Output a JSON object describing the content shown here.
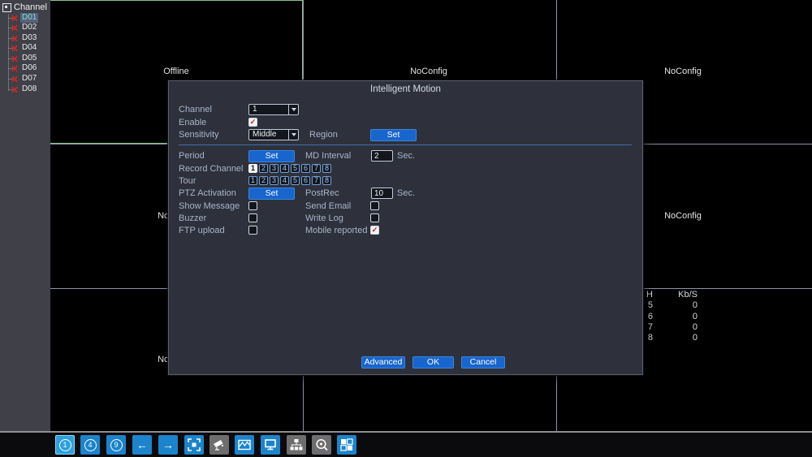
{
  "sidebar": {
    "title": "Channel",
    "items": [
      {
        "label": "D01",
        "selected": true
      },
      {
        "label": "D02",
        "selected": false
      },
      {
        "label": "D03",
        "selected": false
      },
      {
        "label": "D04",
        "selected": false
      },
      {
        "label": "D05",
        "selected": false
      },
      {
        "label": "D06",
        "selected": false
      },
      {
        "label": "D07",
        "selected": false
      },
      {
        "label": "D08",
        "selected": false
      }
    ]
  },
  "grid": {
    "cells": [
      {
        "position": "top-left",
        "label": "Offline"
      },
      {
        "position": "top-center",
        "label": "NoConfig"
      },
      {
        "position": "top-right",
        "label": "NoConfig"
      },
      {
        "position": "middle-left",
        "label": "NoConfig"
      },
      {
        "position": "middle-right",
        "label": "NoConfig"
      },
      {
        "position": "bottom-left",
        "label": "NoConfig"
      }
    ],
    "bitrate_table": {
      "header_ch": "H",
      "header_kbs": "Kb/S",
      "rows": [
        {
          "ch": "5",
          "kbs": "0"
        },
        {
          "ch": "6",
          "kbs": "0"
        },
        {
          "ch": "7",
          "kbs": "0"
        },
        {
          "ch": "8",
          "kbs": "0"
        }
      ]
    },
    "selected_cell_border_color": "#8cc08c"
  },
  "dialog": {
    "title": "Intelligent Motion",
    "channel_label": "Channel",
    "channel_value": "1",
    "enable_label": "Enable",
    "enable_checked": true,
    "enable_check_glyph": "✓",
    "sensitivity_label": "Sensitivity",
    "sensitivity_value": "Middle",
    "region_label": "Region",
    "region_set_label": "Set",
    "period_label": "Period",
    "period_set_label": "Set",
    "md_interval_label": "MD Interval",
    "md_interval_value": "2",
    "md_interval_unit": "Sec.",
    "record_channel_label": "Record Channel",
    "record_channels": [
      "1",
      "2",
      "3",
      "4",
      "5",
      "6",
      "7",
      "8"
    ],
    "record_channel_selected": "1",
    "tour_label": "Tour",
    "tour_channels": [
      "1",
      "2",
      "3",
      "4",
      "5",
      "6",
      "7",
      "8"
    ],
    "ptz_label": "PTZ Activation",
    "ptz_set_label": "Set",
    "postrec_label": "PostRec",
    "postrec_value": "10",
    "postrec_unit": "Sec.",
    "show_message_label": "Show Message",
    "show_message_checked": false,
    "send_email_label": "Send Email",
    "send_email_checked": false,
    "buzzer_label": "Buzzer",
    "buzzer_checked": false,
    "write_log_label": "Write Log",
    "write_log_checked": false,
    "ftp_upload_label": "FTP upload",
    "ftp_upload_checked": false,
    "mobile_reported_label": "Mobile reported",
    "mobile_reported_checked": true,
    "mobile_check_glyph": "✓",
    "advanced_label": "Advanced",
    "ok_label": "OK",
    "cancel_label": "Cancel",
    "accent_color": "#1765cd"
  },
  "toolbar": {
    "icons": [
      {
        "name": "single-view",
        "label": "1"
      },
      {
        "name": "quad-view",
        "label": "4"
      },
      {
        "name": "nine-view",
        "label": "9"
      },
      {
        "name": "prev-channel",
        "label": "←"
      },
      {
        "name": "next-channel",
        "label": "→"
      },
      {
        "name": "record-viewfinder",
        "label": ""
      },
      {
        "name": "ptz-camera",
        "label": ""
      },
      {
        "name": "color-waveform",
        "label": ""
      },
      {
        "name": "monitor",
        "label": ""
      },
      {
        "name": "network",
        "label": ""
      },
      {
        "name": "disk-search",
        "label": ""
      },
      {
        "name": "multi-grid",
        "label": ""
      }
    ]
  }
}
